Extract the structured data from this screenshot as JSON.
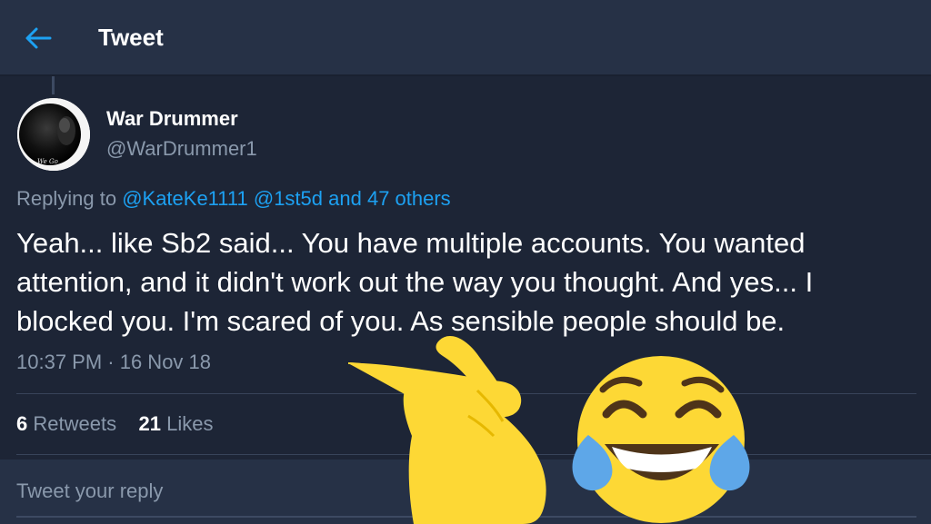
{
  "header": {
    "back_icon": "arrow-left-icon",
    "title": "Tweet",
    "accent": "#1da1f2"
  },
  "author": {
    "avatar_caption": "We Go",
    "name": "War Drummer",
    "handle": "@WarDrummer1"
  },
  "replying": {
    "prefix": "Replying to ",
    "mention1": "@KateKe1111",
    "mention2": "@1st5d",
    "connector": " and ",
    "others": "47 others"
  },
  "tweet": {
    "text": "Yeah... like Sb2 said... You have multiple accounts. You wanted attention, and it didn't work out the way you thought. And yes... I blocked you. I'm scared of you. As sensible people should be.",
    "timestamp": "10:37 PM · 16 Nov 18"
  },
  "stats": {
    "retweets_count": "6",
    "retweets_label": "Retweets",
    "likes_count": "21",
    "likes_label": "Likes"
  },
  "reply_box": {
    "placeholder": "Tweet your reply"
  },
  "overlays": {
    "emoji1": "backhand-index-pointing-right-icon",
    "emoji2": "face-with-tears-of-joy-icon"
  }
}
